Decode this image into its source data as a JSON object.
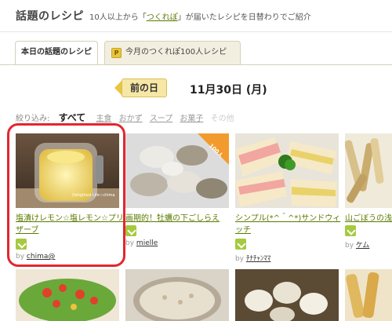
{
  "header": {
    "title": "話題のレシピ",
    "subtitle_pre": "10人以上から「",
    "subtitle_kw": "つくれぽ",
    "subtitle_post": "」が届いたレシピを日替わりでご紹介"
  },
  "tabs": [
    {
      "label": "本日の話題のレシピ",
      "active": true
    },
    {
      "label": "今月のつくれぽ100人レシピ",
      "active": false,
      "icon": "P"
    }
  ],
  "datebar": {
    "prev_label": "前の日",
    "date": "11月30日 (月)"
  },
  "filter": {
    "label": "絞り込み:",
    "items": [
      {
        "label": "すべて",
        "state": "on"
      },
      {
        "label": "主食",
        "state": "link"
      },
      {
        "label": "おかず",
        "state": "link"
      },
      {
        "label": "スープ",
        "state": "link"
      },
      {
        "label": "お菓子",
        "state": "link"
      },
      {
        "label": "その他",
        "state": "off"
      }
    ]
  },
  "recipes": [
    {
      "title": "塩漬けレモン☆塩レモン☆プリザーブ",
      "author": "chima@",
      "photo_caption": "Delighted Life☆chima",
      "highlighted": true
    },
    {
      "title": "画期的！牡蠣の下ごしらえ",
      "author": "mielle",
      "badge": "100人"
    },
    {
      "title": "シンプル(*^＾^*)サンドウィッチ",
      "author": "ﾁﾅﾁｬﾝﾏﾏ"
    },
    {
      "title": "山ごぼうの浅漬",
      "author": "ケム"
    }
  ],
  "by_label": "by"
}
